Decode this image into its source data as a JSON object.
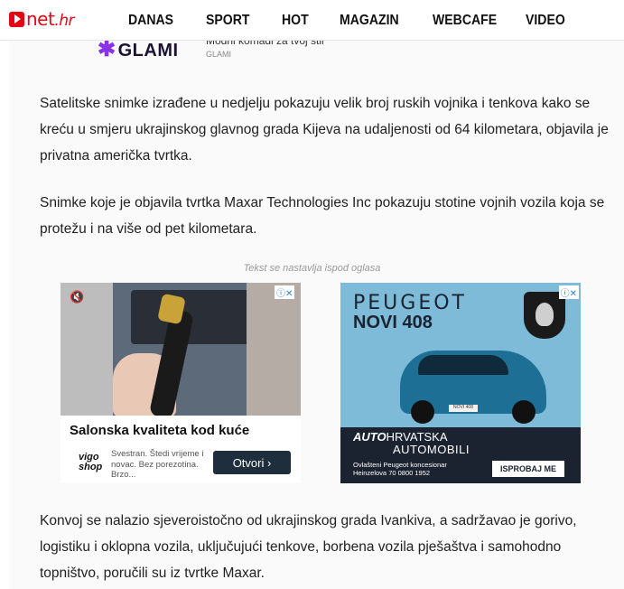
{
  "header": {
    "logo_text": "net",
    "logo_suffix": ".hr",
    "nav": [
      "DANAS",
      "SPORT",
      "HOT",
      "MAGAZIN",
      "WEBCAFE",
      "VIDEO"
    ]
  },
  "glami_ad": {
    "logo": "GLAMI",
    "title": "Modni komadi za tvoj stil",
    "sponsor": "GLAMI"
  },
  "article": {
    "paragraphs": [
      "Satelitske snimke izrađene u nedjelju pokazuju velik broj ruskih vojnika i tenkova kako se kreću u smjeru ukrajinskog glavnog grada Kijeva na udaljenosti od 64 kilometara, objavila je privatna američka tvrtka.",
      "Snimke koje je objavila tvrtka Maxar Technologies Inc pokazuju stotine vojnih vozila koja se protežu i na više od pet kilometara.",
      "Konvoj se nalazio sjeveroistočno od ukrajinskog grada Ivankiva, a sadržavao je gorivo, logistiku i oklopna vozila, uključujući tenkove, borbena vozila pješaštva i samohodno topništvo, poručili su iz tvrtke Maxar."
    ],
    "ad_notice": "Tekst se nastavlja ispod oglasa"
  },
  "ad_left": {
    "title": "Salonska kvaliteta kod kuće",
    "brand": "vigo shop",
    "brand_line1": "vigo",
    "brand_line2": "shop",
    "description": "Svestran. Štedi vrijeme i novac. Bez porezotina. Brzo...",
    "cta": "Otvori ›"
  },
  "ad_right": {
    "brand": "PEUGEOT",
    "model": "NOVI 408",
    "dealer_prefix": "AUTO",
    "dealer_line1": "HRVATSKA",
    "dealer_line2": "AUTOMOBILI",
    "address": "Ovlašteni Peugeot koncesionar Heinzelova 70     0800 1952",
    "cta": "ISPROBAJ ME",
    "plate": "NOVI 408"
  },
  "colors": {
    "brand_red": "#e30613",
    "glami_purple": "#8b31e6",
    "peugeot_navy": "#1b2331",
    "ad_sky": "#7dbbd8"
  }
}
